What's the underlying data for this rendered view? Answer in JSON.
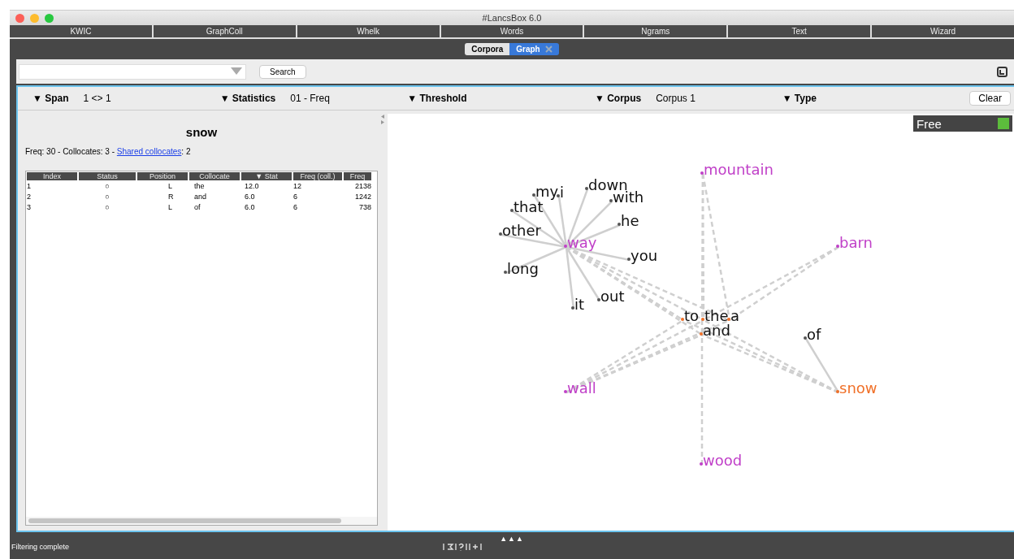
{
  "window": {
    "title": "#LancsBox 6.0"
  },
  "tools": [
    {
      "label": "KWIC"
    },
    {
      "label": "GraphColl"
    },
    {
      "label": "Whelk"
    },
    {
      "label": "Words"
    },
    {
      "label": "Ngrams"
    },
    {
      "label": "Text"
    },
    {
      "label": "Wizard"
    }
  ],
  "tabs": [
    {
      "label": "Corpora",
      "selected": false,
      "closable": false
    },
    {
      "label": "Graph",
      "selected": true,
      "closable": true
    }
  ],
  "search": {
    "button": "Search"
  },
  "filters": [
    {
      "label": "▼ Span",
      "value": "1 <> 1"
    },
    {
      "label": "▼ Statistics",
      "value": "01 - Freq"
    },
    {
      "label": "▼ Threshold"
    },
    {
      "label": "▼ Corpus",
      "value": "Corpus 1"
    },
    {
      "label": "▼ Type"
    }
  ],
  "clear_button": "Clear",
  "node_info": {
    "title": "snow",
    "summary": "Freq: 30 - Collocates: 3 - ",
    "link": "Shared collocates",
    "link_suffix": ": 2"
  },
  "table": {
    "columns": [
      "Index",
      "Status",
      "Position",
      "Collocate",
      "▼ Stat",
      "Freq (coll.)",
      "Freq"
    ],
    "rows": [
      [
        "1",
        "○",
        "L",
        "the",
        "12.0",
        "12",
        "2138"
      ],
      [
        "2",
        "○",
        "R",
        "and",
        "6.0",
        "6",
        "1242"
      ],
      [
        "3",
        "○",
        "L",
        "of",
        "6.0",
        "6",
        "738"
      ]
    ]
  },
  "graph": {
    "mode": "Free",
    "mode_on": true,
    "nodes": [
      {
        "label": "mountain",
        "kind": "node"
      },
      {
        "label": "my",
        "kind": "collocate"
      },
      {
        "label": "i",
        "kind": "collocate"
      },
      {
        "label": "down",
        "kind": "collocate"
      },
      {
        "label": "with",
        "kind": "collocate"
      },
      {
        "label": "that",
        "kind": "collocate"
      },
      {
        "label": "he",
        "kind": "collocate"
      },
      {
        "label": "other",
        "kind": "collocate"
      },
      {
        "label": "way",
        "kind": "node"
      },
      {
        "label": "barn",
        "kind": "node"
      },
      {
        "label": "you",
        "kind": "collocate"
      },
      {
        "label": "long",
        "kind": "collocate"
      },
      {
        "label": "it",
        "kind": "collocate"
      },
      {
        "label": "out",
        "kind": "collocate"
      },
      {
        "label": "to",
        "kind": "shared"
      },
      {
        "label": "the",
        "kind": "shared"
      },
      {
        "label": "a",
        "kind": "shared"
      },
      {
        "label": "and",
        "kind": "shared"
      },
      {
        "label": "of",
        "kind": "collocate"
      },
      {
        "label": "wall",
        "kind": "node"
      },
      {
        "label": "snow",
        "kind": "focus"
      },
      {
        "label": "wood",
        "kind": "node"
      }
    ]
  },
  "expand_handle": "▲▲▲",
  "status_bar": {
    "text": "Filtering complete"
  }
}
